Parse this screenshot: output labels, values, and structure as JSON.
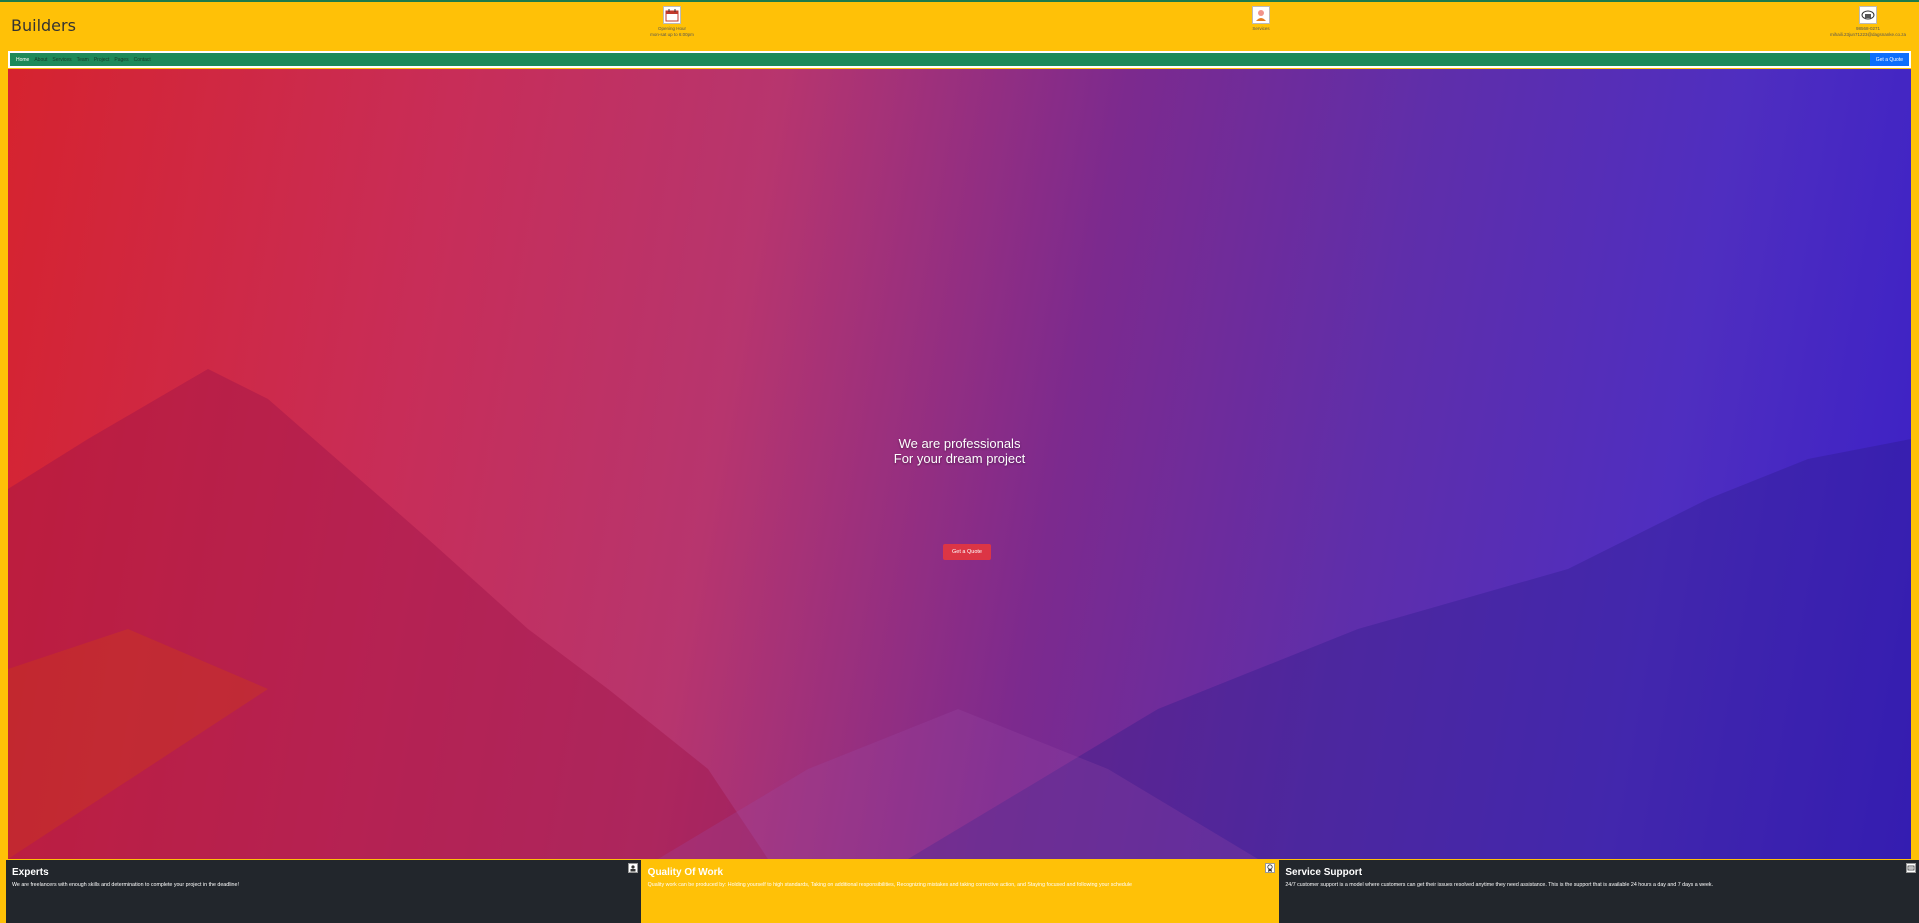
{
  "brand": "Builders",
  "header": {
    "hours": {
      "line1": "Opening Hour",
      "line2": "mon-sat up to 6:00pm",
      "icon": "calendar-icon"
    },
    "services": {
      "label": "Services",
      "icon": "person-icon"
    },
    "contact": {
      "line1": "98568-0271",
      "line2": "mihaili.23jun71223@dagsnanke.co.za",
      "icon": "phone-icon"
    }
  },
  "nav": {
    "items": [
      "Home",
      "About",
      "Services",
      "Team",
      "Project",
      "Pages",
      "Contact"
    ],
    "quote_label": "Get a Quote"
  },
  "hero": {
    "line1": "We are professionals",
    "line2": "For your dream project",
    "button_label": "Get a Quote"
  },
  "features": [
    {
      "title": "Experts",
      "text": "We are freelancers with enough skills and determination to complete your project in the deadline!",
      "icon": "user-icon"
    },
    {
      "title": "Quality Of Work",
      "text": "Quality work can be produced by: Holding yourself to high standards, Taking on additional responsibilities, Recognizing mistakes and taking corrective action, and Staying focused and following your schedule",
      "icon": "badge-icon"
    },
    {
      "title": "Service Support",
      "text": "24/7 customer support is a model where customers can get their issues resolved anytime they need assistance. This is the support that is available 24 hours a day and 7 days a week.",
      "icon": "support-icon"
    }
  ],
  "colors": {
    "header_bg": "#ffc107",
    "nav_bg": "#1d8a5a",
    "quote_btn": "#0d6efd",
    "hero_btn": "#dc3545",
    "dark_card": "#22262c"
  }
}
